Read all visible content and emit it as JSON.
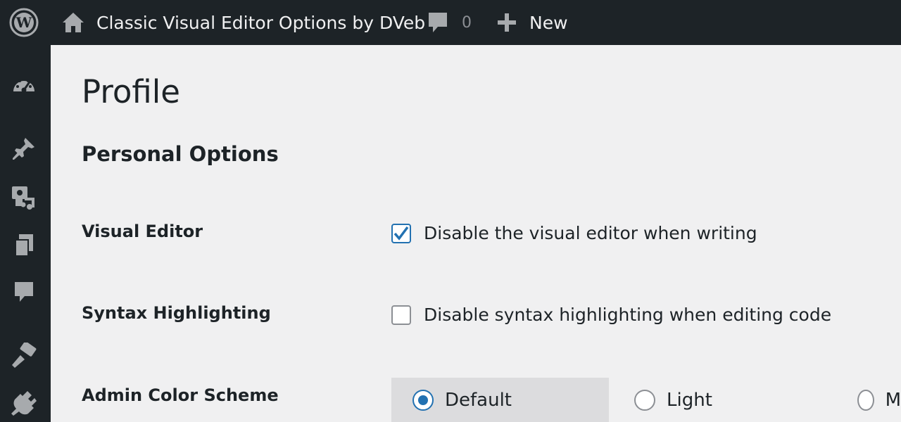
{
  "adminbar": {
    "site_name": "Classic Visual Editor Options by DVeb",
    "comments_count": "0",
    "new_label": "New",
    "icons": [
      "wordpress-logo-icon",
      "home-icon",
      "comment-bubble-icon",
      "plus-icon"
    ]
  },
  "sidebar": {
    "items": [
      {
        "icon": "dashboard-icon"
      },
      {
        "icon": "pushpin-icon"
      },
      {
        "icon": "media-icon"
      },
      {
        "icon": "pages-icon"
      },
      {
        "icon": "comments-icon"
      },
      {
        "icon": "appearance-icon"
      },
      {
        "icon": "plugins-icon"
      }
    ]
  },
  "main": {
    "page_title": "Profile",
    "section_title": "Personal Options",
    "visual_editor": {
      "label": "Visual Editor",
      "checkbox_label": "Disable the visual editor when writing",
      "checked": true
    },
    "syntax_highlighting": {
      "label": "Syntax Highlighting",
      "checkbox_label": "Disable syntax highlighting when editing code",
      "checked": false
    },
    "admin_color_scheme": {
      "label": "Admin Color Scheme",
      "options": [
        {
          "label": "Default",
          "selected": true
        },
        {
          "label": "Light",
          "selected": false
        },
        {
          "label": "M",
          "selected": false
        }
      ]
    }
  },
  "colors": {
    "adminbar_bg": "#1d2327",
    "accent": "#2271b1",
    "page_bg": "#f0f0f1",
    "selected_option_bg": "#dcdcde"
  }
}
